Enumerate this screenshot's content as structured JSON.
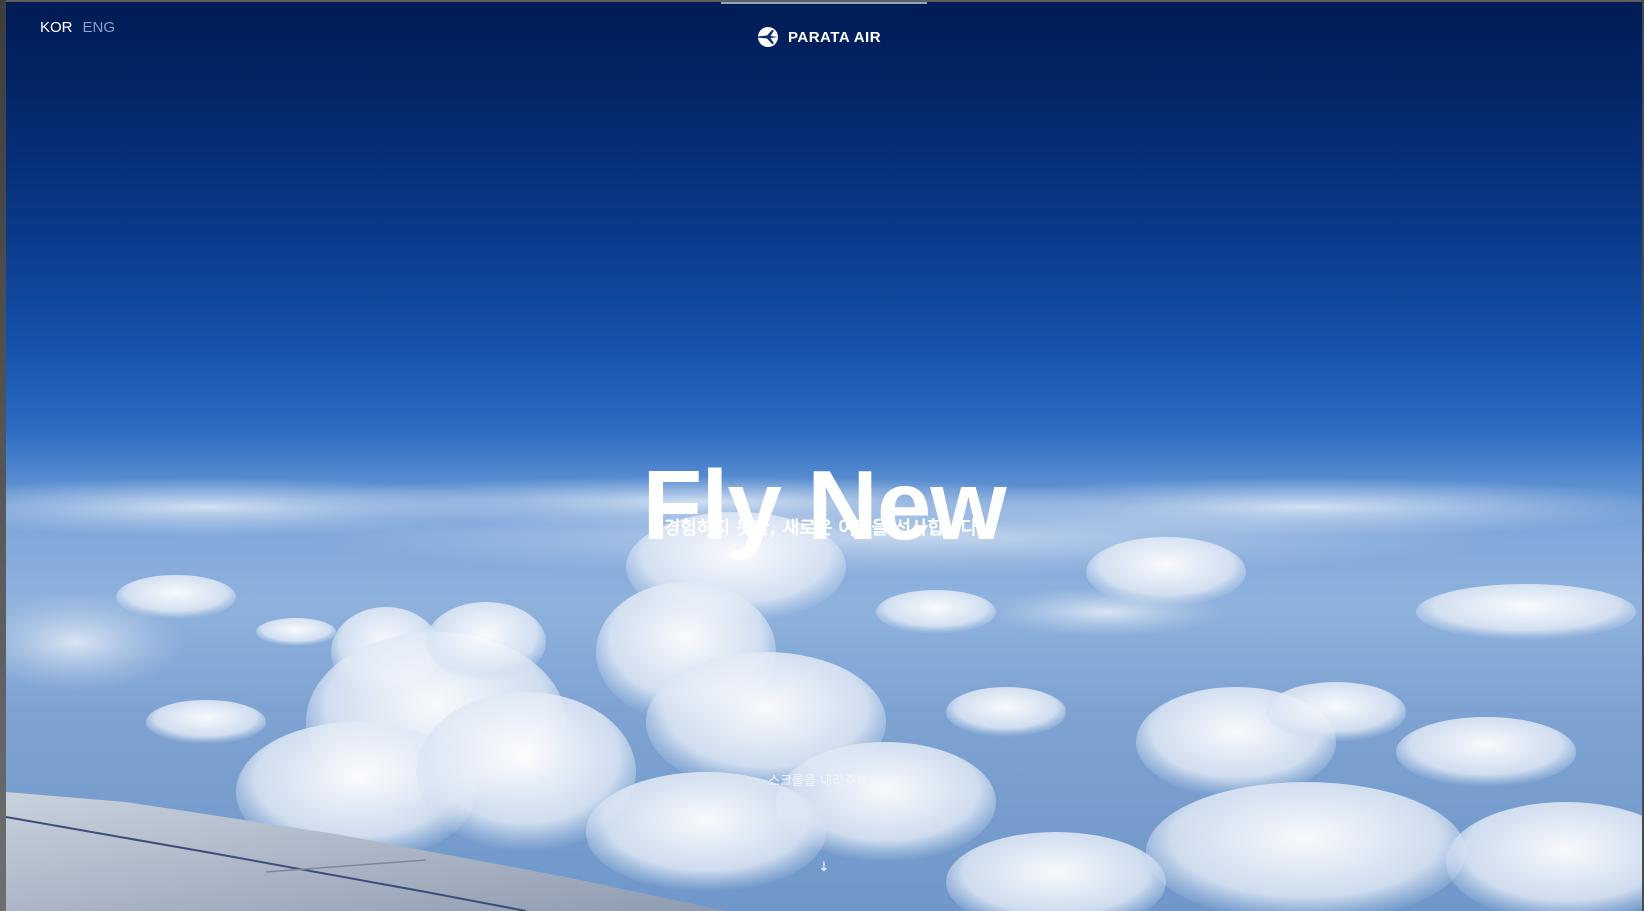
{
  "header": {
    "languages": [
      {
        "label": "KOR",
        "active": true
      },
      {
        "label": "ENG",
        "active": false
      }
    ],
    "logo": {
      "icon": "airplane-globe-icon",
      "text": "PARATA AIR"
    }
  },
  "hero": {
    "title": "Fly New",
    "subtitle": "경험하지 못한, 새로운 여정을 선사합니다.",
    "scroll_hint": "스크롤을 내려주세요",
    "scroll_arrow": "↓",
    "scroll_arrow_icon": "arrow-down-icon"
  },
  "colors": {
    "sky_top": "#011b54",
    "sky_mid": "#1552ad",
    "cloud": "#e9f0f9",
    "text": "#ffffff",
    "lang_inactive": "#8d9fc4"
  }
}
